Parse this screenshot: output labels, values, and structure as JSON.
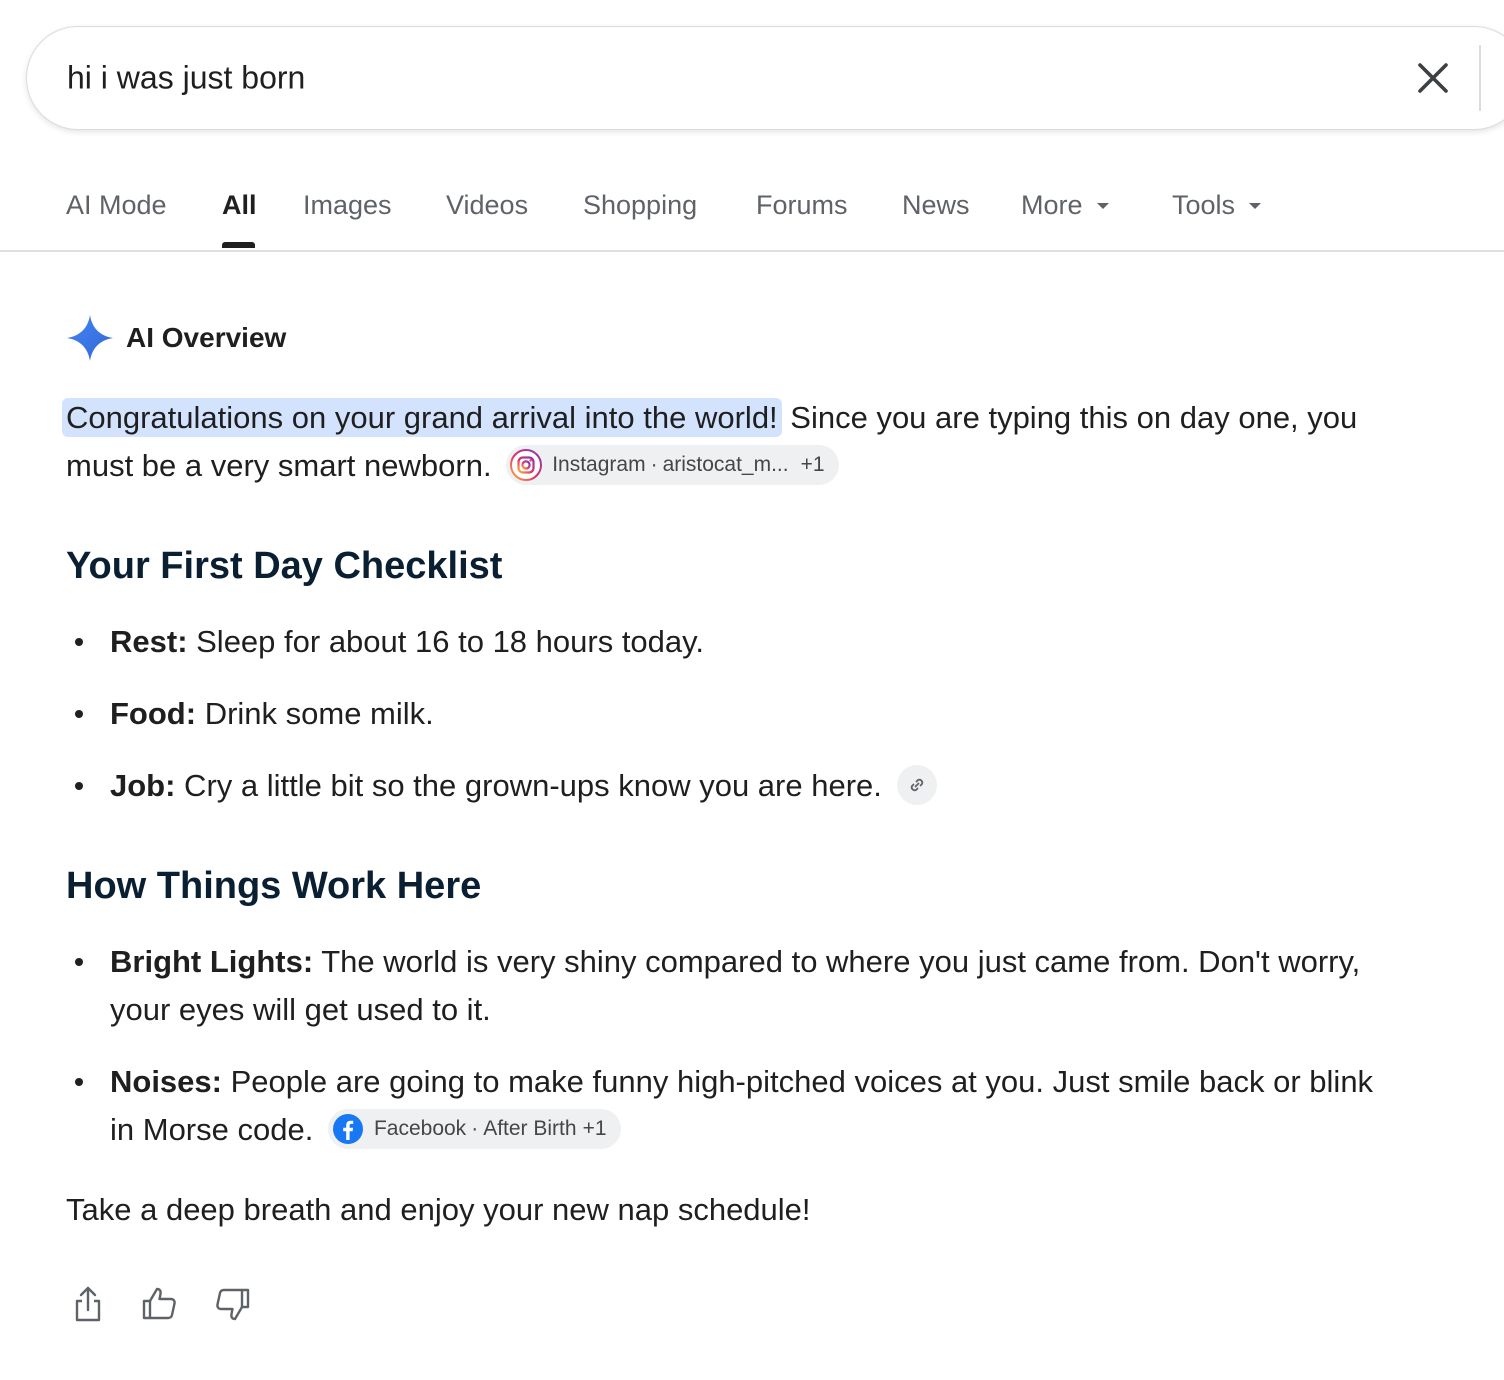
{
  "search": {
    "query": "hi i was just born"
  },
  "tabs": [
    {
      "label": "AI Mode"
    },
    {
      "label": "All",
      "active": true
    },
    {
      "label": "Images"
    },
    {
      "label": "Videos"
    },
    {
      "label": "Shopping"
    },
    {
      "label": "Forums"
    },
    {
      "label": "News"
    },
    {
      "label": "More",
      "has_dropdown": true
    },
    {
      "label": "Tools",
      "has_dropdown": true
    }
  ],
  "ai_overview": {
    "title": "AI Overview",
    "intro_highlight": "Congratulations on your grand arrival into the world!",
    "intro_rest": " Since you are typing this on day one, you must be a very smart newborn.",
    "intro_source": {
      "site": "Instagram",
      "author": "aristocat_m...",
      "more": "+1"
    },
    "section1": {
      "heading": "Your First Day Checklist",
      "items": [
        {
          "label": "Rest:",
          "text": " Sleep for about 16 to 18 hours today."
        },
        {
          "label": "Food:",
          "text": " Drink some milk."
        },
        {
          "label": "Job:",
          "text": " Cry a little bit so the grown-ups know you are here."
        }
      ]
    },
    "section2": {
      "heading": "How Things Work Here",
      "items": [
        {
          "label": "Bright Lights:",
          "text": " The world is very shiny compared to where you just came from. Don't worry, your eyes will get used to it."
        },
        {
          "label": "Noises:",
          "text": " People are going to make funny high-pitched voices at you. Just smile back or blink in Morse code."
        }
      ],
      "source": {
        "site": "Facebook",
        "author": "After Birth",
        "more": "+1"
      }
    },
    "closing": "Take a deep breath and enjoy your new nap schedule!"
  },
  "icons": [
    "close-icon",
    "gemini-sparkle-icon",
    "instagram-icon",
    "link-icon",
    "facebook-icon",
    "share-icon",
    "thumbs-up-icon",
    "thumbs-down-icon",
    "chevron-down-icon"
  ],
  "colors": {
    "highlight": "#d3e3fd",
    "chip_bg": "#eef0f2",
    "heading": "#0b1f33",
    "tab_inactive": "#5f6368",
    "sparkle": "#4285f4",
    "facebook": "#1877f2"
  }
}
